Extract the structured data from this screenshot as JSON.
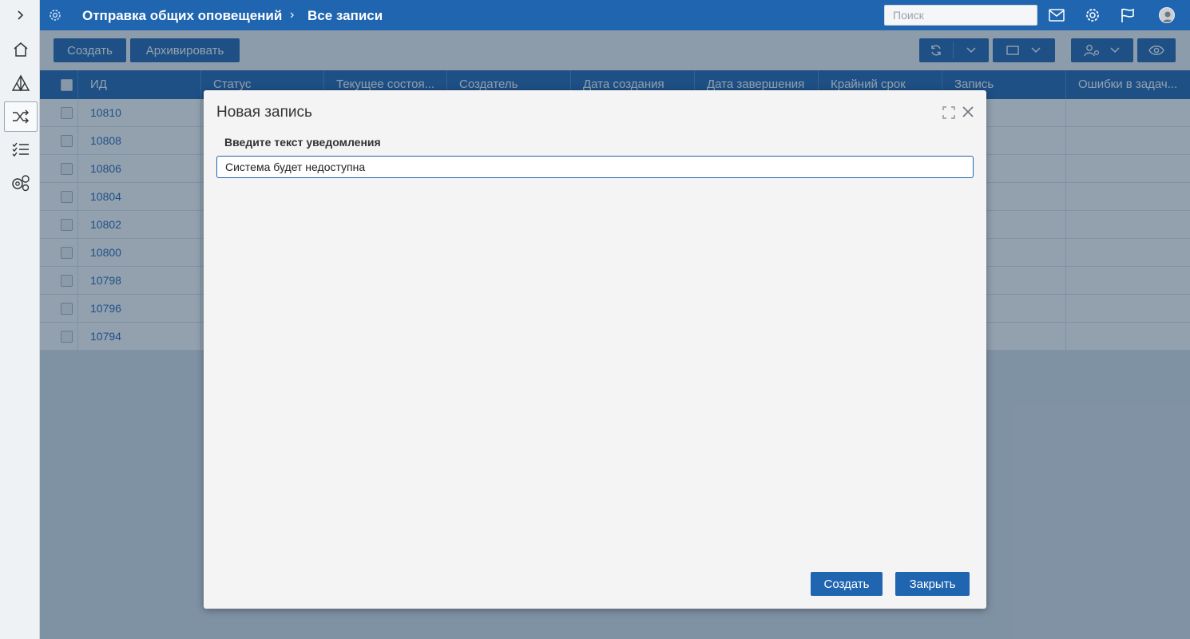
{
  "header": {
    "breadcrumb_root": "Отправка общих оповещений",
    "breadcrumb_separator": "›",
    "breadcrumb_current": "Все записи",
    "search_placeholder": "Поиск",
    "icons": [
      "settings-icon",
      "mail-icon",
      "gear-icon",
      "flag-icon",
      "avatar"
    ]
  },
  "sidebar": {
    "items": [
      "expand-icon",
      "home-icon",
      "tree-icon",
      "shuffle-icon",
      "checklist-icon",
      "gears-icon"
    ],
    "active": "shuffle-icon"
  },
  "toolbar": {
    "create_label": "Создать",
    "archive_label": "Архивировать"
  },
  "grid": {
    "columns": [
      "ИД",
      "Статус",
      "Текущее состоя...",
      "Создатель",
      "Дата создания",
      "Дата завершения",
      "Крайний срок",
      "Запись",
      "Ошибки в задач..."
    ],
    "rows": [
      "10810",
      "10808",
      "10806",
      "10804",
      "10802",
      "10800",
      "10798",
      "10796",
      "10794"
    ]
  },
  "modal": {
    "title": "Новая запись",
    "field_label": "Введите текст уведомления",
    "field_value": "Система будет недоступна",
    "create_label": "Создать",
    "close_label": "Закрыть"
  },
  "colors": {
    "primary": "#1f65b0",
    "header_bg": "#1f65b0",
    "overlay": "rgba(30,58,88,0.48)",
    "modal_bg": "#f4f4f4"
  }
}
